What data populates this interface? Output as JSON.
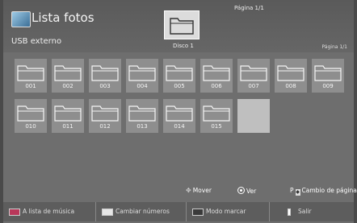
{
  "header": {
    "app_title": "Lista fotos",
    "source": "USB externo",
    "disk_label": "Disco 1",
    "page_top": "Página 1/1",
    "page_right": "Página 1/1"
  },
  "folders": [
    "001",
    "002",
    "003",
    "004",
    "005",
    "006",
    "007",
    "008",
    "009",
    "010",
    "011",
    "012",
    "013",
    "014",
    "015"
  ],
  "hints": {
    "move": "Mover",
    "view": "Ver",
    "page_change_key": "P",
    "page_change": "Cambio de página"
  },
  "buttons": [
    {
      "label": "A lista de música",
      "color": "#b8385a"
    },
    {
      "label": "Cambiar números",
      "color": "#e6e6e6"
    },
    {
      "label": "Modo marcar",
      "color": "#3a3a3a"
    },
    {
      "label": "Salir",
      "color": "#ffffff"
    }
  ]
}
